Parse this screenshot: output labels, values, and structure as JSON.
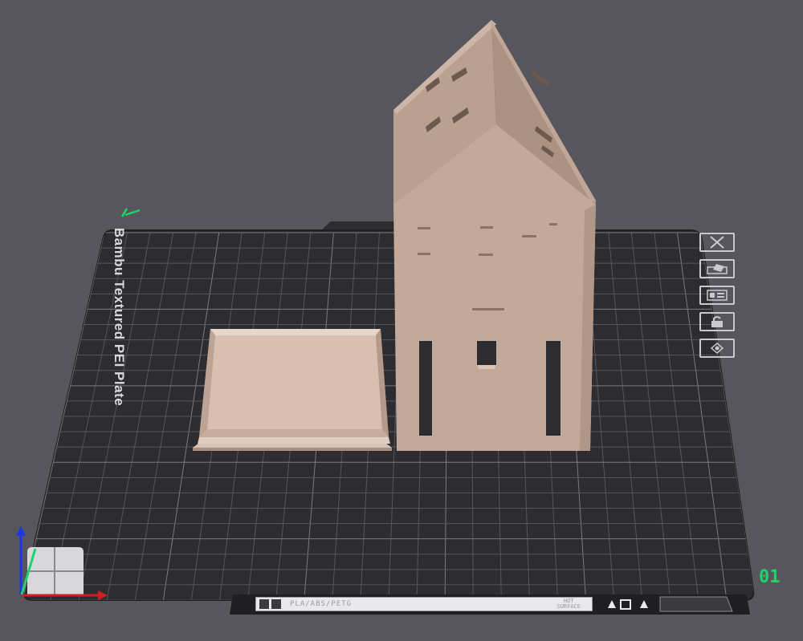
{
  "plate": {
    "name": "Bambu Textured PEI Plate",
    "index": "01",
    "materials": "PLA/ABS/PETG",
    "hot_surface": [
      "HOT",
      "SURFACE"
    ]
  },
  "toolbar": {
    "items": [
      {
        "name": "close-plate-button",
        "icon": "close-icon"
      },
      {
        "name": "auto-orient-button",
        "icon": "orient-icon"
      },
      {
        "name": "arrange-button",
        "icon": "arrange-icon"
      },
      {
        "name": "lock-plate-button",
        "icon": "lock-icon"
      },
      {
        "name": "plate-settings-button",
        "icon": "settings-icon"
      }
    ]
  },
  "colors": {
    "background": "#56565c",
    "plate": "#2c2c31",
    "grid": "#6a6a70",
    "model": "#c9b0a2",
    "accent": "#1fd36b"
  }
}
